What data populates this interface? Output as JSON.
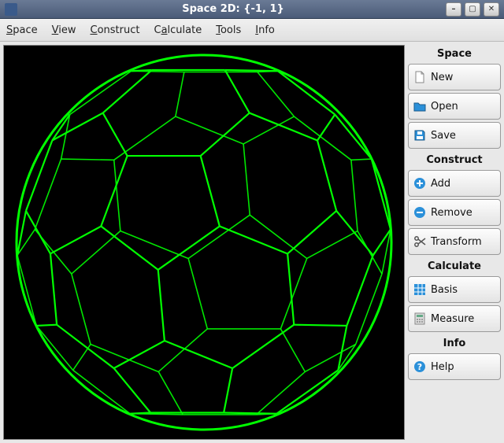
{
  "window": {
    "title": "Space 2D: {-1, 1}"
  },
  "menubar": {
    "items": [
      {
        "label": "Space",
        "accel": "S"
      },
      {
        "label": "View",
        "accel": "V"
      },
      {
        "label": "Construct",
        "accel": "C"
      },
      {
        "label": "Calculate",
        "accel": "a"
      },
      {
        "label": "Tools",
        "accel": "T"
      },
      {
        "label": "Info",
        "accel": "I"
      }
    ]
  },
  "sidebar": {
    "groups": [
      {
        "title": "Space",
        "buttons": [
          {
            "name": "new",
            "label": "New"
          },
          {
            "name": "open",
            "label": "Open"
          },
          {
            "name": "save",
            "label": "Save"
          }
        ]
      },
      {
        "title": "Construct",
        "buttons": [
          {
            "name": "add",
            "label": "Add"
          },
          {
            "name": "remove",
            "label": "Remove"
          },
          {
            "name": "transform",
            "label": "Transform"
          }
        ]
      },
      {
        "title": "Calculate",
        "buttons": [
          {
            "name": "basis",
            "label": "Basis"
          },
          {
            "name": "measure",
            "label": "Measure"
          }
        ]
      },
      {
        "title": "Info",
        "buttons": [
          {
            "name": "help",
            "label": "Help"
          }
        ]
      }
    ]
  },
  "canvas": {
    "shape": "truncated-icosahedron-wireframe",
    "stroke": "#00ff00",
    "background": "#000000"
  }
}
